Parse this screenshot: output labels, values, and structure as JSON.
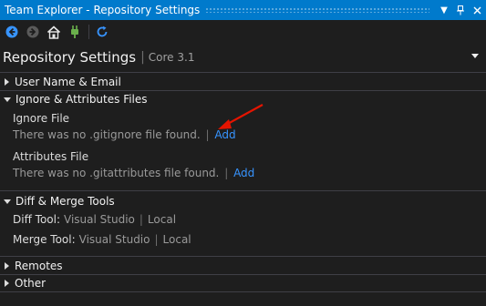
{
  "window": {
    "title": "Team Explorer - Repository Settings"
  },
  "toolbar": {
    "buttons": [
      "back-icon",
      "forward-icon",
      "home-icon",
      "connect-icon",
      "refresh-icon"
    ]
  },
  "header": {
    "title": "Repository Settings",
    "separator": "|",
    "subtitle": "Core 3.1"
  },
  "sections": {
    "user": {
      "label": "User Name & Email",
      "expanded": false
    },
    "ignore": {
      "label": "Ignore & Attributes Files",
      "expanded": true,
      "ignore_file": {
        "heading": "Ignore File",
        "message": "There was no .gitignore file found.",
        "separator": "|",
        "action": "Add"
      },
      "attributes_file": {
        "heading": "Attributes File",
        "message": "There was no .gitattributes file found.",
        "separator": "|",
        "action": "Add"
      }
    },
    "diff": {
      "label": "Diff & Merge Tools",
      "expanded": true,
      "diff_tool": {
        "label": "Diff Tool:",
        "value": "Visual Studio",
        "separator": "|",
        "scope": "Local"
      },
      "merge_tool": {
        "label": "Merge Tool:",
        "value": "Visual Studio",
        "separator": "|",
        "scope": "Local"
      }
    },
    "remotes": {
      "label": "Remotes",
      "expanded": false
    },
    "other": {
      "label": "Other",
      "expanded": false
    }
  },
  "colors": {
    "accent": "#007acc",
    "link": "#3794ff",
    "background": "#1e1e1e",
    "annotation": "#e51400"
  }
}
